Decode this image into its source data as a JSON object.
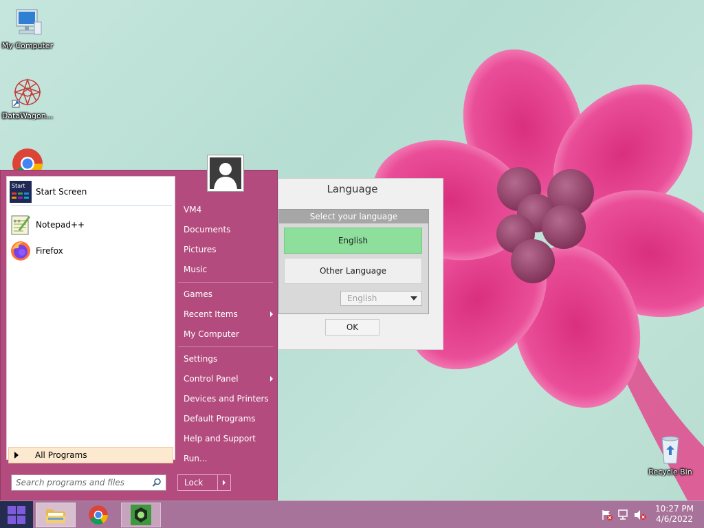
{
  "desktop": {
    "icons": [
      {
        "label": "My Computer"
      },
      {
        "label": "DataWagon..."
      },
      {
        "label": "Recycle Bin"
      }
    ]
  },
  "start_menu": {
    "pinned": [
      {
        "label": "Start Screen",
        "icon_text": "Start"
      },
      {
        "label": "Notepad++"
      },
      {
        "label": "Firefox"
      }
    ],
    "all_programs": "All Programs",
    "search_placeholder": "Search programs and files",
    "right": {
      "user": "VM4",
      "documents": "Documents",
      "pictures": "Pictures",
      "music": "Music",
      "games": "Games",
      "recent_items": "Recent Items",
      "my_computer": "My Computer",
      "settings": "Settings",
      "control_panel": "Control Panel",
      "devices_printers": "Devices and Printers",
      "default_programs": "Default Programs",
      "help_support": "Help and Support",
      "run": "Run..."
    },
    "lock": "Lock"
  },
  "language_dialog": {
    "title": "Language",
    "header": "Select your language",
    "english": "English",
    "other": "Other Language",
    "select_value": "English",
    "ok": "OK"
  },
  "taskbar": {
    "time": "10:27 PM",
    "date": "4/6/2022"
  },
  "colors": {
    "start_menu_bg": "#b44b7e",
    "taskbar_bg": "#a8739a",
    "english_selected": "#8fdf9c",
    "all_programs_highlight": "#fde9d0"
  }
}
